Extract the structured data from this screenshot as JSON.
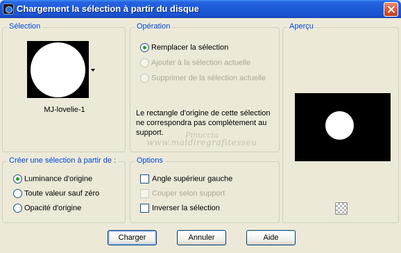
{
  "window": {
    "title": "Chargement la sélection à partir du disque"
  },
  "selection": {
    "legend": "Sélection",
    "thumbnail_label": "MJ-lovelie-1"
  },
  "operation": {
    "legend": "Opération",
    "options": [
      {
        "label": "Remplacer la sélection",
        "checked": true,
        "disabled": false
      },
      {
        "label": "Ajouter à la sélection actuelle",
        "checked": false,
        "disabled": true
      },
      {
        "label": "Supprimer de la sélection actuelle",
        "checked": false,
        "disabled": true
      }
    ],
    "note": "Le rectangle d'origine de cette sélection ne correspondra pas complètement au support."
  },
  "preview": {
    "legend": "Aperçu"
  },
  "create": {
    "legend": "Créer une sélection à partir de :",
    "options": [
      {
        "label": "Luminance d'origine",
        "checked": true
      },
      {
        "label": "Toute valeur sauf zéro",
        "checked": false
      },
      {
        "label": "Opacité d'origine",
        "checked": false
      }
    ]
  },
  "options": {
    "legend": "Options",
    "items": [
      {
        "label": "Angle supérieur gauche",
        "checked": false,
        "disabled": false
      },
      {
        "label": "Couper selon support",
        "checked": false,
        "disabled": true
      },
      {
        "label": "Inverser la sélection",
        "checked": false,
        "disabled": false
      }
    ]
  },
  "watermark": {
    "line1": "Pinuccia",
    "line2": "www.maldiregrafitesseu"
  },
  "buttons": {
    "charger": "Charger",
    "annuler": "Annuler",
    "aide": "Aide"
  },
  "colors": {
    "titlebar": "#1d5ad8",
    "legend_text": "#0046d5",
    "dialog_bg": "#ece9d8"
  },
  "icons": {
    "app": "app-icon",
    "close": "close-icon",
    "dropdown": "chevron-down-icon",
    "transparency": "checkerboard-icon"
  }
}
